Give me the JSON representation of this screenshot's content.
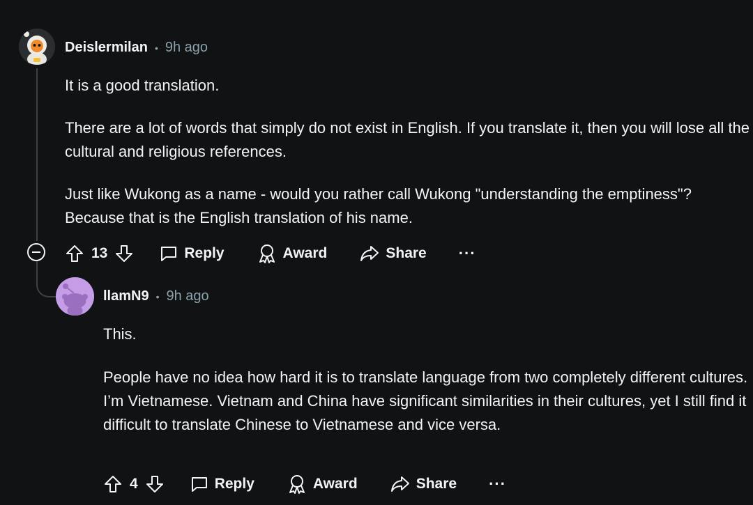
{
  "comments": [
    {
      "username": "Deislermilan",
      "separator": "•",
      "time": "9h ago",
      "paragraphs": [
        "It is a good translation.",
        "There are a lot of words that simply do not exist in English. If you translate it, then you will lose all the cultural and religious references.",
        "Just like Wukong as a name - would you rather call Wukong \"understanding the emptiness\"? Because that is the English translation of his name."
      ],
      "votes": "13",
      "actions": {
        "reply": "Reply",
        "award": "Award",
        "share": "Share",
        "more": "···"
      }
    },
    {
      "username": "llamN9",
      "separator": "•",
      "time": "9h ago",
      "paragraphs": [
        "This.",
        "People have no idea how hard it is to translate language from two completely different cultures. I’m Vietnamese. Vietnam and China have significant similarities in their cultures, yet I still find it difficult to translate Chinese to Vietnamese and vice versa."
      ],
      "votes": "4",
      "actions": {
        "reply": "Reply",
        "award": "Award",
        "share": "Share",
        "more": "···"
      }
    }
  ],
  "icons": {
    "collapse": "minus-circle-icon",
    "upvote": "arrow-up-icon",
    "downvote": "arrow-down-icon",
    "reply": "speech-bubble-icon",
    "award": "award-ribbon-icon",
    "share": "share-arrow-icon"
  },
  "colors": {
    "background": "#101214",
    "text": "#f2f4f5",
    "meta": "#8ba2ad",
    "avatar2": "#c59ce6"
  }
}
